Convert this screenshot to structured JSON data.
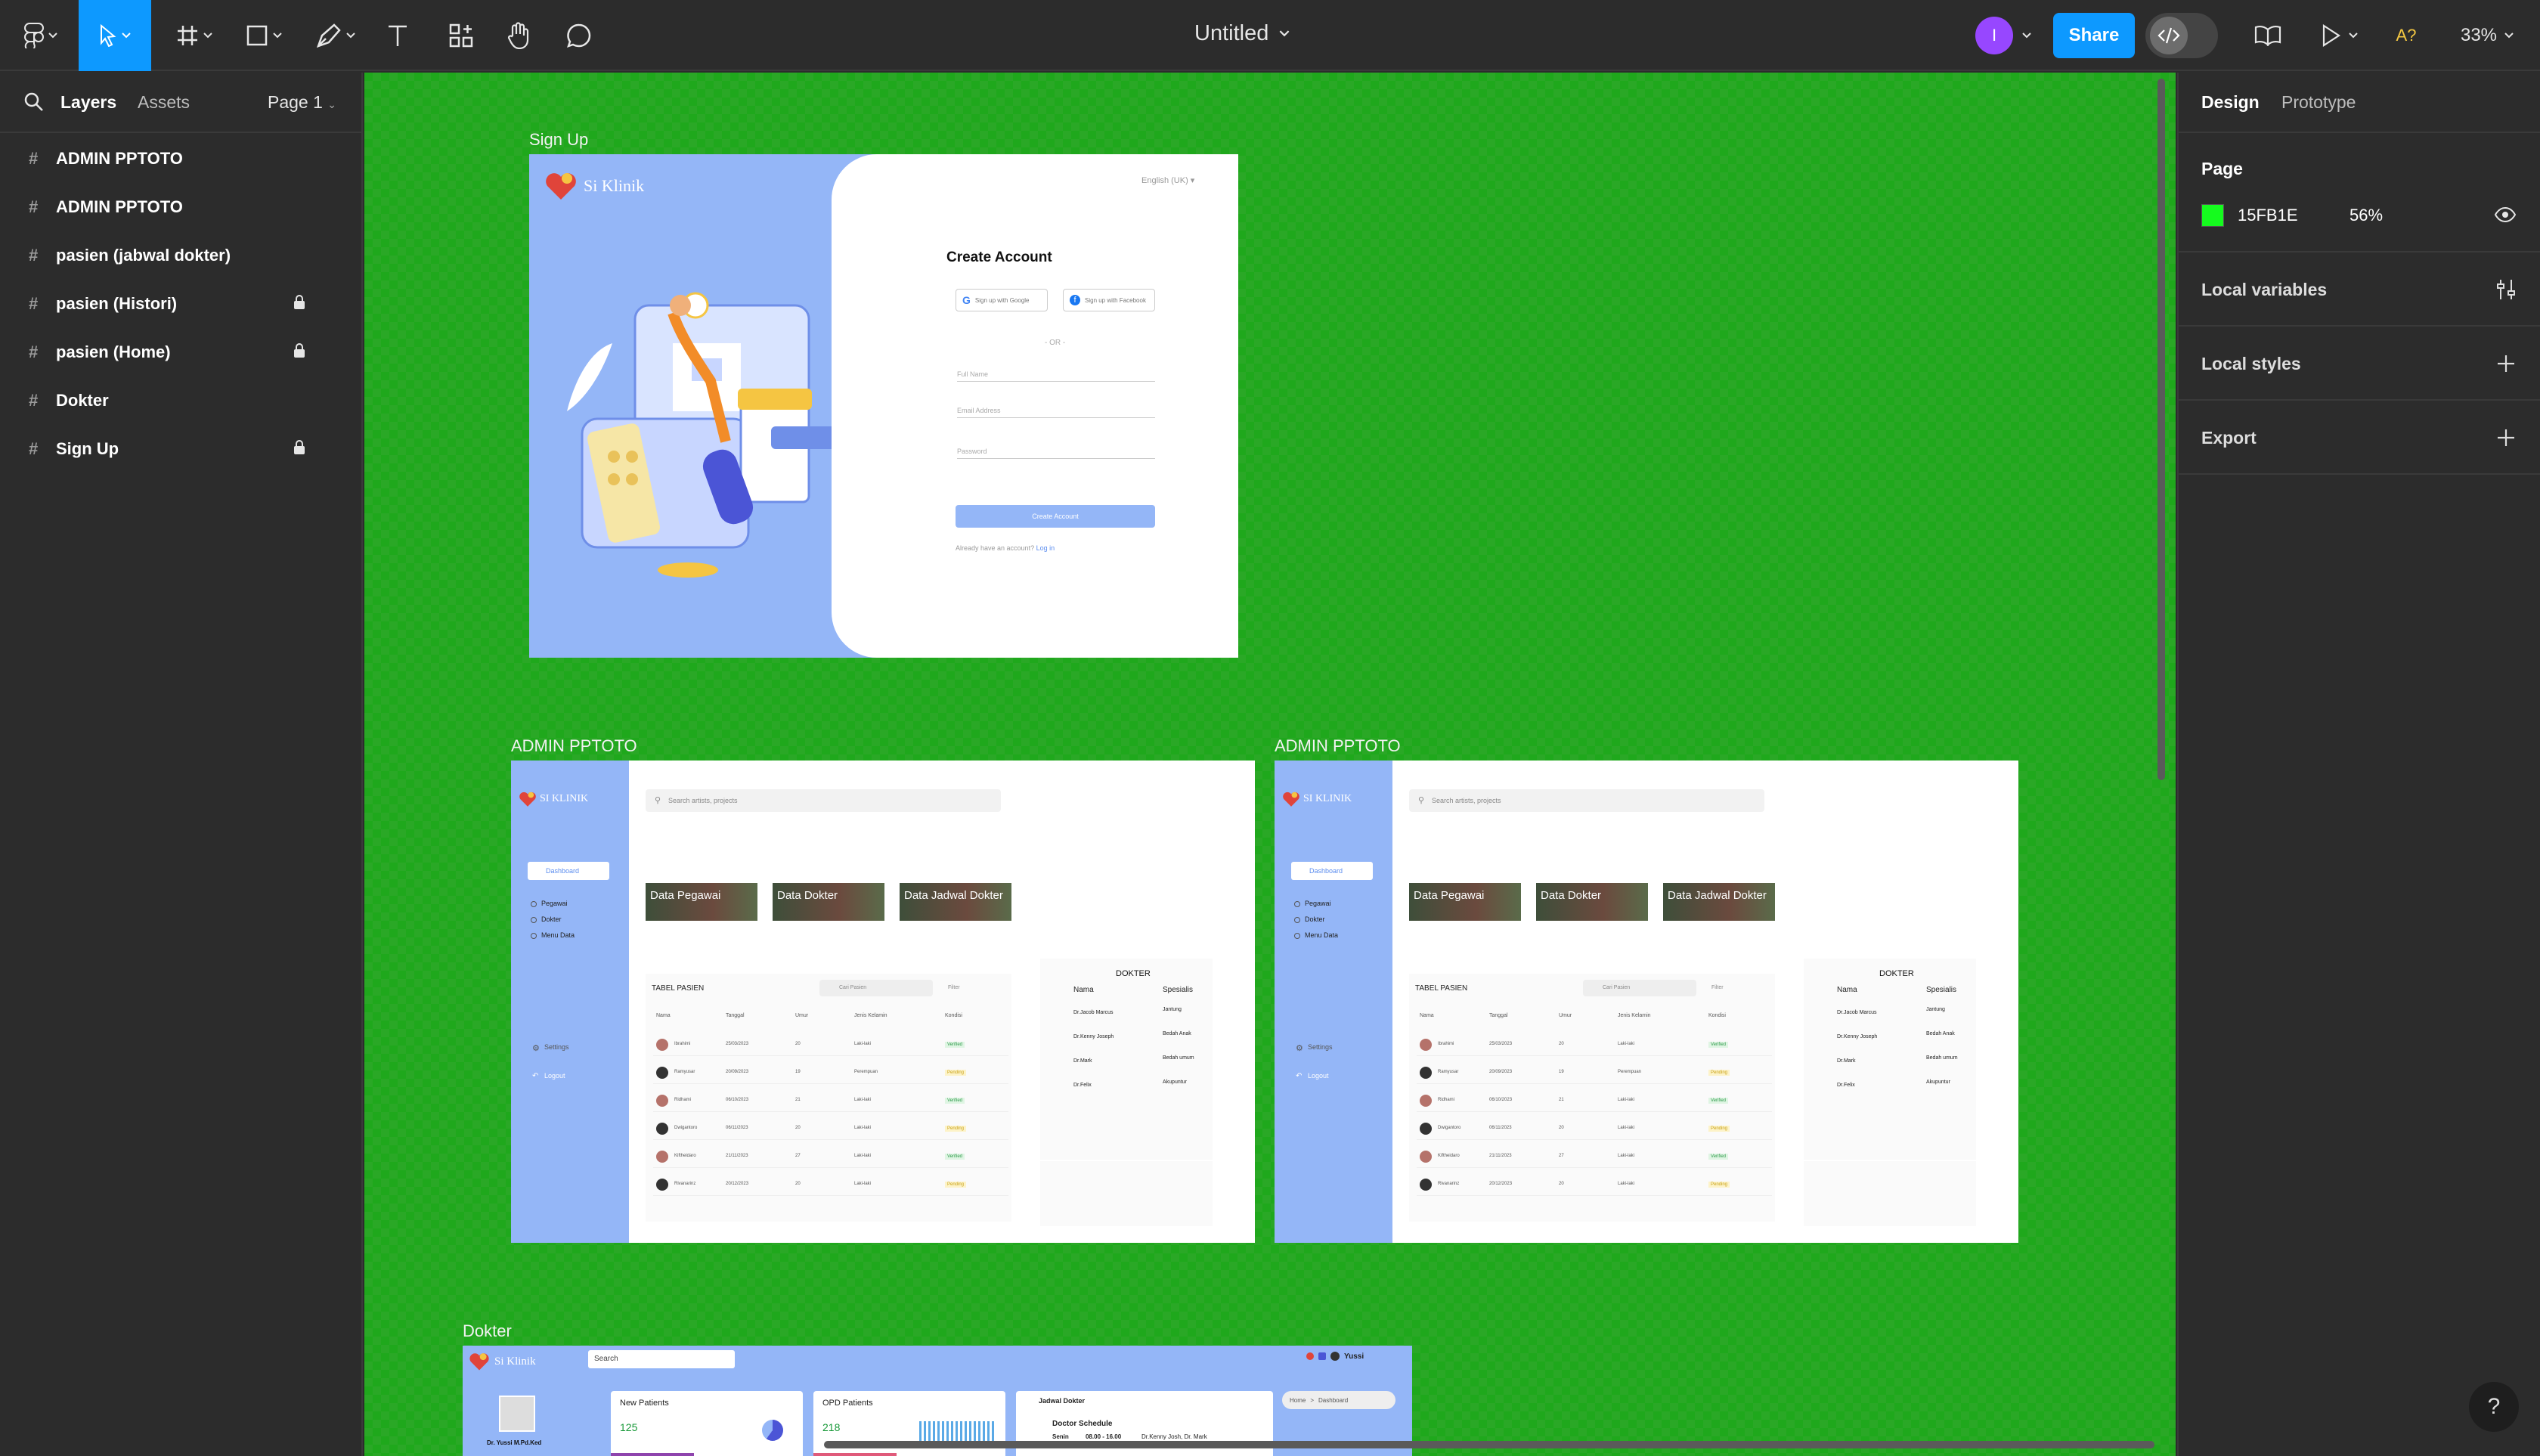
{
  "toolbar": {
    "file_title": "Untitled",
    "share_label": "Share",
    "avatar_initial": "I",
    "zoom": "33%",
    "font_warning": "A?"
  },
  "left_panel": {
    "tabs": [
      "Layers",
      "Assets"
    ],
    "page_selector": "Page 1",
    "layers": [
      {
        "name": "ADMIN PPTOTO",
        "locked": false
      },
      {
        "name": "ADMIN PPTOTO",
        "locked": false
      },
      {
        "name": "pasien (jabwal dokter)",
        "locked": false
      },
      {
        "name": "pasien (Histori)",
        "locked": true
      },
      {
        "name": "pasien (Home)",
        "locked": true
      },
      {
        "name": "Dokter",
        "locked": false
      },
      {
        "name": "Sign Up",
        "locked": true
      }
    ]
  },
  "right_panel": {
    "tabs": [
      "Design",
      "Prototype"
    ],
    "page_heading": "Page",
    "page_color_hex": "15FB1E",
    "page_opacity": "56%",
    "swatch_color": "#15fb1e",
    "sections": [
      "Local variables",
      "Local styles",
      "Export"
    ]
  },
  "canvas": {
    "frame_labels": {
      "signup": "Sign Up",
      "admin1": "ADMIN PPTOTO",
      "admin2": "ADMIN PPTOTO",
      "dokter": "Dokter"
    },
    "signup": {
      "brand": "Si Klinik",
      "language": "English (UK)",
      "heading": "Create Account",
      "google_btn": "Sign up with Google",
      "facebook_btn": "Sign up with Facebook",
      "divider": "- OR -",
      "fields": [
        "Full Name",
        "Email Address",
        "Password"
      ],
      "submit": "Create Account",
      "login_prompt": "Already have an account?",
      "login_link": "Log in"
    },
    "admin": {
      "brand": "SI KLINIK",
      "search_placeholder": "Search artists, projects",
      "nav_active": "Dashboard",
      "nav": [
        "Pegawai",
        "Dokter",
        "Menu Data"
      ],
      "settings": "Settings",
      "logout": "Logout",
      "cards": [
        "Data Pegawai",
        "Data Dokter",
        "Data Jadwal Dokter"
      ],
      "table_title": "TABEL PASIEN",
      "table_search": "Cari Pasien",
      "table_filter": "Filter",
      "columns": [
        "Nama",
        "Tanggal",
        "Umur",
        "Jenis Kelamin",
        "Kondisi"
      ],
      "rows": [
        [
          "Ibrahimi",
          "25/03/2023",
          "20",
          "Laki-laki",
          "Verified"
        ],
        [
          "Ramyusar",
          "20/09/2023",
          "19",
          "Perempuan",
          "Pending"
        ],
        [
          "Ridhami",
          "06/10/2023",
          "21",
          "Laki-laki",
          "Verified"
        ],
        [
          "Dwigantoro",
          "06/11/2023",
          "20",
          "Laki-laki",
          "Pending"
        ],
        [
          "Kiftheidaro",
          "21/11/2023",
          "27",
          "Laki-laki",
          "Verified"
        ],
        [
          "Rivanarinz",
          "20/12/2023",
          "20",
          "Laki-laki",
          "Pending"
        ]
      ],
      "doctor_title": "DOKTER",
      "doctor_columns": [
        "Nama",
        "Spesialis"
      ],
      "doctors": [
        [
          "Dr.Jacob Marcus",
          "Jantung"
        ],
        [
          "Dr.Kenny Joseph",
          "Bedah Anak"
        ],
        [
          "Dr.Mark",
          "Bedah umum"
        ],
        [
          "Dr.Felix",
          "Akupuntur"
        ]
      ]
    },
    "dokter": {
      "brand": "Si Klinik",
      "search": "Search",
      "user": "Yussi",
      "doctor_name": "Dr. Yussi M.Pd.Ked",
      "new_patients_label": "New Patients",
      "new_patients_value": "125",
      "opd_label": "OPD Patients",
      "opd_value": "218",
      "schedule_heading": "Jadwal Dokter",
      "schedule_sub": "Doctor Schedule",
      "schedule_day": "Senin",
      "schedule_time": "08.00 - 16.00",
      "schedule_doctors": "Dr.Kenny Josh, Dr. Mark",
      "crumb_home": "Home",
      "crumb_page": "Dashboard"
    }
  }
}
